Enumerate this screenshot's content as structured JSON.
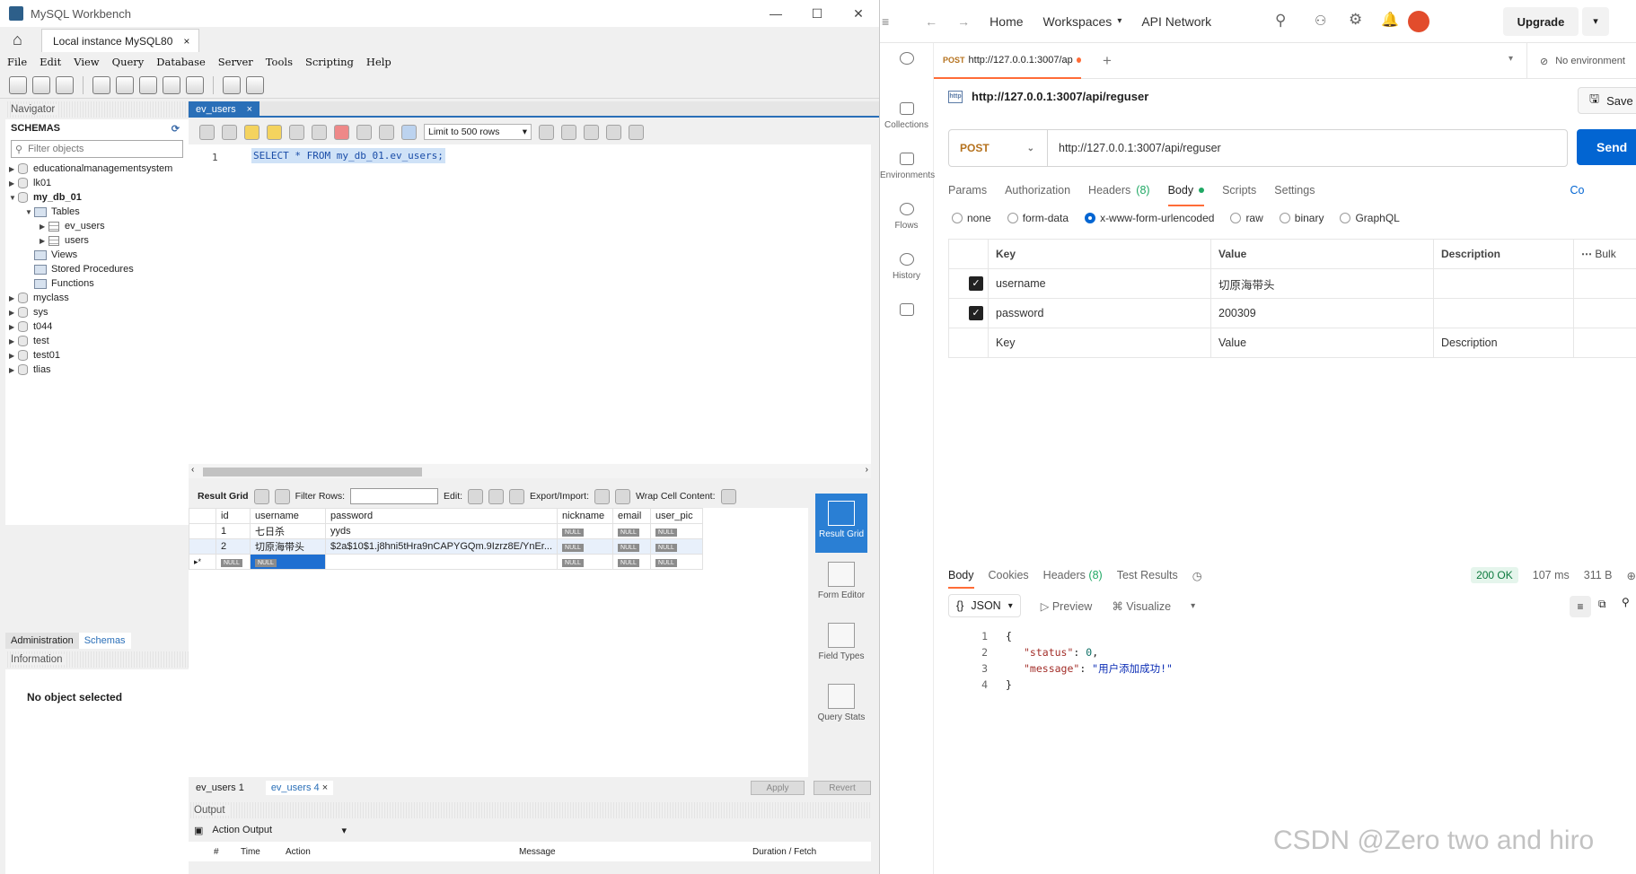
{
  "workbench": {
    "window_title": "MySQL Workbench",
    "connection_tab": "Local instance MySQL80",
    "menu": [
      "File",
      "Edit",
      "View",
      "Query",
      "Database",
      "Server",
      "Tools",
      "Scripting",
      "Help"
    ],
    "navigator_label": "Navigator",
    "schemas_label": "SCHEMAS",
    "filter_placeholder": "Filter objects",
    "schemas": [
      "educationalmanagementsystem",
      "lk01",
      "my_db_01",
      "myclass",
      "sys",
      "t044",
      "test",
      "test01",
      "tlias"
    ],
    "my_db_01_children": {
      "tables_label": "Tables",
      "tables": [
        "ev_users",
        "users"
      ],
      "views": "Views",
      "procedures": "Stored Procedures",
      "functions": "Functions"
    },
    "nav_tabs": [
      "Administration",
      "Schemas"
    ],
    "information_label": "Information",
    "no_object": "No object selected",
    "editor_tab": "ev_users",
    "limit_label": "Limit to 500 rows",
    "line_number": "1",
    "sql": "SELECT * FROM my_db_01.ev_users;",
    "result_toolbar": {
      "result_grid": "Result Grid",
      "filter_rows": "Filter Rows:",
      "edit": "Edit:",
      "export_import": "Export/Import:",
      "wrap": "Wrap Cell Content:"
    },
    "grid": {
      "columns": [
        "id",
        "username",
        "password",
        "nickname",
        "email",
        "user_pic"
      ],
      "rows": [
        [
          "1",
          "七日杀",
          "yyds",
          "NULL",
          "NULL",
          "NULL"
        ],
        [
          "2",
          "切原海带头",
          "$2a$10$1.j8hni5tHra9nCAPYGQm.9Izrz8E/YnEr...",
          "NULL",
          "NULL",
          "NULL"
        ],
        [
          "NULL",
          "NULL",
          "",
          "NULL",
          "NULL",
          "NULL"
        ]
      ]
    },
    "side_buttons": [
      "Result Grid",
      "Form Editor",
      "Field Types",
      "Query Stats"
    ],
    "result_tabs": [
      "ev_users 1",
      "ev_users 4"
    ],
    "apply": "Apply",
    "revert": "Revert",
    "output_label": "Output",
    "action_output": "Action Output",
    "output_columns": [
      "#",
      "Time",
      "Action",
      "Message",
      "Duration / Fetch"
    ]
  },
  "postman": {
    "nav": {
      "home": "Home",
      "workspaces": "Workspaces",
      "api_network": "API Network",
      "upgrade": "Upgrade"
    },
    "sidebar": [
      "Collections",
      "Environments",
      "Flows",
      "History"
    ],
    "req_tab": {
      "method": "POST",
      "url": "http://127.0.0.1:3007/ap"
    },
    "environment": "No environment",
    "title_url": "http://127.0.0.1:3007/api/reguser",
    "save": "Save",
    "method": "POST",
    "url": "http://127.0.0.1:3007/api/reguser",
    "send": "Send",
    "request_tabs": [
      "Params",
      "Authorization",
      "Headers",
      "(8)",
      "Body",
      "Scripts",
      "Settings",
      "Co"
    ],
    "body_types": [
      "none",
      "form-data",
      "x-www-form-urlencoded",
      "raw",
      "binary",
      "GraphQL"
    ],
    "kv_headers": [
      "Key",
      "Value",
      "Description",
      "Bulk"
    ],
    "kv_rows": [
      {
        "key": "username",
        "value": "切原海带头"
      },
      {
        "key": "password",
        "value": "200309"
      }
    ],
    "kv_placeholder": {
      "key": "Key",
      "value": "Value",
      "desc": "Description"
    },
    "response_tabs": [
      "Body",
      "Cookies",
      "Headers",
      "(8)",
      "Test Results"
    ],
    "status": "200 OK",
    "time": "107 ms",
    "size": "311 B",
    "format": "JSON",
    "preview": "Preview",
    "visualize": "Visualize",
    "json_lines": [
      "1",
      "2",
      "3",
      "4"
    ],
    "json": {
      "open": "{",
      "status_key": "\"status\"",
      "status_val": "0",
      "message_key": "\"message\"",
      "message_val": "\"用户添加成功!\"",
      "close": "}"
    }
  },
  "watermark": "CSDN @Zero two and hiro"
}
